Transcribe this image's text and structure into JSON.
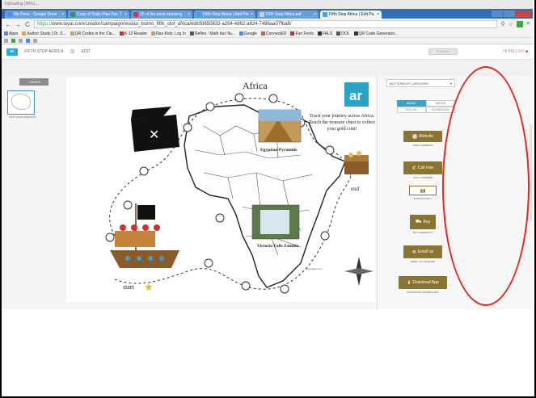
{
  "upload_status": "Uploading (99%)...",
  "tabs": [
    {
      "label": "My Drive - Google Drive",
      "color": "#4a8cf6",
      "active": false
    },
    {
      "label": "Copy of Daily Plan Dec 7",
      "color": "#2e9b48",
      "active": false
    },
    {
      "label": "26 of the most stunning",
      "color": "#d6382e",
      "active": false
    },
    {
      "label": "Fifth Stop Africa | Add Pin",
      "color": "#3aa8e0",
      "active": false
    },
    {
      "label": "Fifth Stop Africa.pdf",
      "color": "#cfcfcf",
      "active": false
    },
    {
      "label": "Fifth Stop Africa | Edit Pa",
      "color": "#3aa8e0",
      "active": true
    }
  ],
  "address_bar": {
    "url_prefix": "https://",
    "url": "www.layar.com/creator/campaign/wsdau_bsimo_fifth_stof_africa/edit/fd650832-a264-4d62-a824-7496aa07fba8/"
  },
  "bookmarks": [
    {
      "label": "Apps",
      "color": "#4a8cf6"
    },
    {
      "label": "Author Study | Dr. S...",
      "color": "#e7a23a"
    },
    {
      "label": "QR Codes in the Cla...",
      "color": "#d0a050"
    },
    {
      "label": "K-12 Reader",
      "color": "#c43030"
    },
    {
      "label": "Raz-Kids: Log In",
      "color": "#d0a050"
    },
    {
      "label": "Reflex : Math fact flu...",
      "color": "#555555"
    },
    {
      "label": "Google",
      "color": "#4a8cf6"
    },
    {
      "label": "ConnectED",
      "color": "#e25a2a"
    },
    {
      "label": "Fun Fonts",
      "color": "#c43030"
    },
    {
      "label": "FALS",
      "color": "#333333"
    },
    {
      "label": "DOL",
      "color": "#555555"
    },
    {
      "label": "QR Code Generator...",
      "color": "#333333"
    }
  ],
  "layar_header": {
    "logo_text": "ar",
    "campaign": "FIFTH STOP AFRICA",
    "edit_label": "EDIT",
    "publish_label": "PUBLISH",
    "user_label": "Hi BELLISY"
  },
  "pages_panel": {
    "add_pages_label": "+ PAGES",
    "thumb_label": "FIFTH STOP AFRICA A4"
  },
  "map": {
    "title": "Africa",
    "logo_text": "ar",
    "instructions": "Track your journey across  Africa. Reach the treasure chest to collect your gold coin!",
    "pyramids_caption": "Egyptian Pyramids",
    "falls_caption": "Victoria Falls Zambia",
    "end_label": "end",
    "start_label": "start",
    "copyright": "www.layar.com"
  },
  "right_panel": {
    "category_select": "BUTTONS BY CATEGORY",
    "category_tabs": [
      "BASIC",
      "MEDIA",
      "SOCIAL",
      "ADVANCED"
    ],
    "active_tab": "BASIC",
    "buttons": [
      {
        "label": "Website",
        "caption": "OPEN A WEBSITE",
        "icon": "globe-icon"
      },
      {
        "label": "Call now",
        "caption": "CALL A NUMBER",
        "icon": "phone-icon"
      },
      {
        "label": "",
        "caption": "VOTE IN A POLL",
        "icon": "poll-icon"
      },
      {
        "label": "Buy",
        "caption": "BUY A PRODUCT",
        "icon": "cart-icon"
      },
      {
        "label": "Email us",
        "caption": "SEND YOU AN EMAIL",
        "icon": "mail-icon"
      },
      {
        "label": "Download App",
        "caption": "DOWNLOAD A MOBILE APP",
        "icon": "download-icon"
      }
    ],
    "accent_color": "#8a7432",
    "highlight_color": "#e8251c"
  }
}
